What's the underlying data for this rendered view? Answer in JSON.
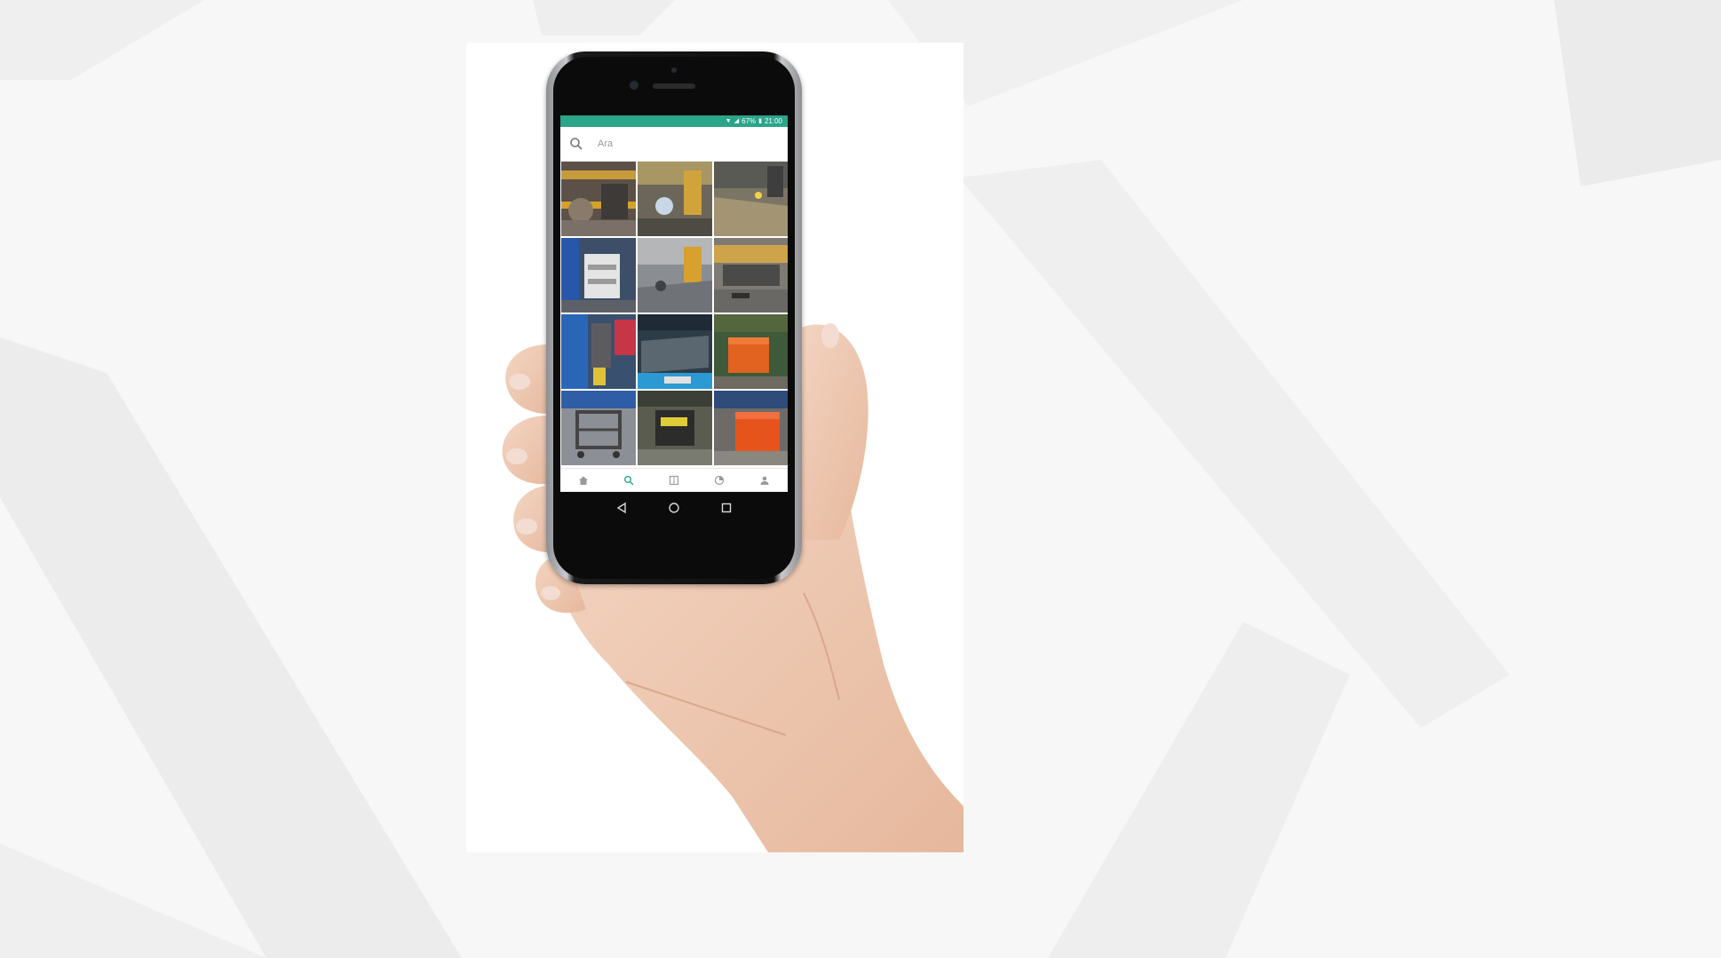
{
  "phone": {
    "status_bar": {
      "battery": "67%",
      "time": "21:00"
    },
    "search": {
      "placeholder": "Ara"
    },
    "gallery": {
      "items": [
        "workshop-machinery",
        "welding-station",
        "factory-floor",
        "blue-cabinet-cart",
        "storage-area",
        "press-machine",
        "blue-equipment-rack",
        "metal-sheet-stack",
        "orange-bin",
        "metal-cart",
        "tool-trolley",
        "orange-container"
      ]
    },
    "tab_bar": {
      "icons": [
        "home-icon",
        "search-icon",
        "grid-icon",
        "chart-icon",
        "profile-icon"
      ],
      "active": "search-icon"
    },
    "nav_bar": {
      "icons": [
        "back-icon",
        "home-circle-icon",
        "recents-icon"
      ]
    }
  },
  "colors": {
    "status_bar": "#2aa58a",
    "active_tab": "#2aa58a",
    "background": "#f7f7f7"
  }
}
